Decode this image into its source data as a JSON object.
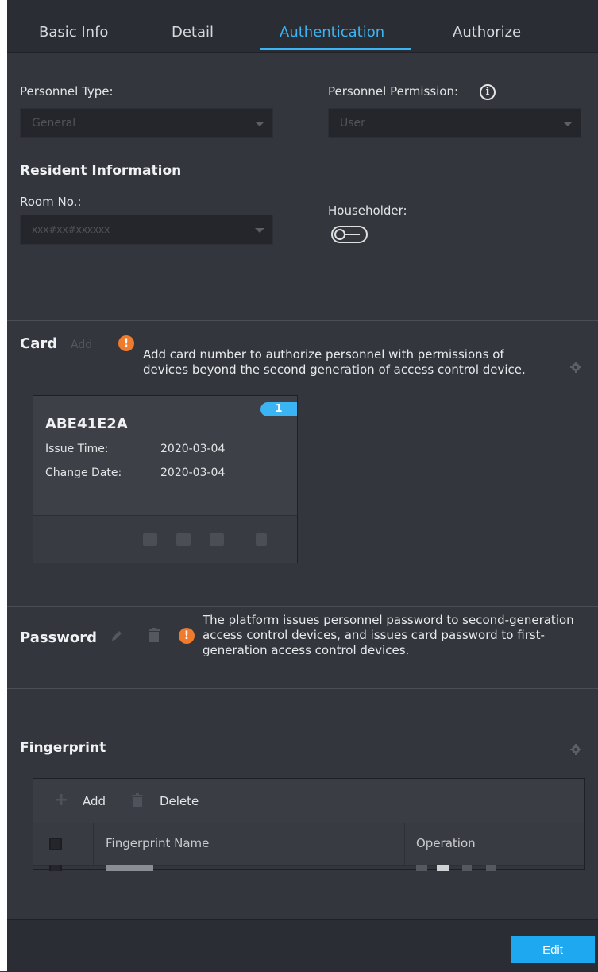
{
  "tabs": [
    "Basic Info",
    "Detail",
    "Authentication",
    "Authorize"
  ],
  "form": {
    "personnel_type_label": "Personnel Type:",
    "personnel_type_value": "General",
    "personnel_permission_label": "Personnel Permission:",
    "personnel_permission_value": "User",
    "resident_heading": "Resident Information",
    "room_label": "Room No.:",
    "room_placeholder": "xxx#xx#xxxxxx",
    "householder_label": "Householder:"
  },
  "card_section": {
    "title": "Card",
    "add_label": "Add",
    "note_line1": "Add card number to authorize personnel with permissions of",
    "note_line2": "devices beyond the second generation of access control device.",
    "card": {
      "number": "ABE41E2A",
      "badge": "1",
      "issue_time_label": "Issue Time:",
      "issue_time_value": "2020-03-04",
      "change_date_label": "Change Date:",
      "change_date_value": "2020-03-04"
    }
  },
  "password_section": {
    "title": "Password",
    "note_line1": "The platform issues personnel password to second-generation",
    "note_line2": "access control devices, and issues card password to first-",
    "note_line3": "generation access control devices."
  },
  "fingerprint_section": {
    "title": "Fingerprint",
    "add_label": "Add",
    "delete_label": "Delete",
    "col_name": "Fingerprint Name",
    "col_operation": "Operation"
  },
  "footer": {
    "edit_label": "Edit"
  },
  "colors": {
    "accent": "#3ab4f2",
    "warning": "#f07b2d",
    "background": "#33363d"
  }
}
